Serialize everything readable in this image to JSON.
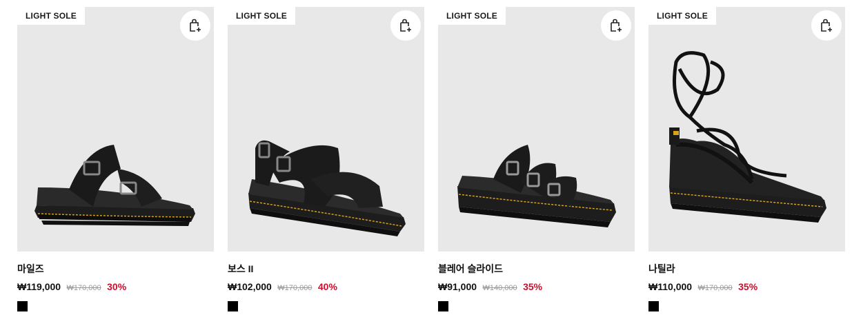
{
  "products": [
    {
      "badge": "LIGHT SOLE",
      "name": "마일즈",
      "price": "₩119,000",
      "original_price": "₩170,000",
      "discount": "30%",
      "swatch_color": "#000000",
      "icon": "add-to-cart-icon",
      "image": "two-strap-buckle-slide-sandal"
    },
    {
      "badge": "LIGHT SOLE",
      "name": "보스 II",
      "price": "₩102,000",
      "original_price": "₩170,000",
      "discount": "40%",
      "swatch_color": "#000000",
      "icon": "add-to-cart-icon",
      "image": "crossover-strap-sandal"
    },
    {
      "badge": "LIGHT SOLE",
      "name": "블레어 슬라이드",
      "price": "₩91,000",
      "original_price": "₩140,000",
      "discount": "35%",
      "swatch_color": "#000000",
      "icon": "add-to-cart-icon",
      "image": "three-buckle-slide-sandal"
    },
    {
      "badge": "LIGHT SOLE",
      "name": "나틸라",
      "price": "₩110,000",
      "original_price": "₩170,000",
      "discount": "35%",
      "swatch_color": "#000000",
      "icon": "add-to-cart-icon",
      "image": "lace-up-gladiator-sandal"
    }
  ],
  "colors": {
    "image_bg": "#e8e8e8",
    "discount": "#c8102e",
    "stitch": "#d9a21b"
  }
}
